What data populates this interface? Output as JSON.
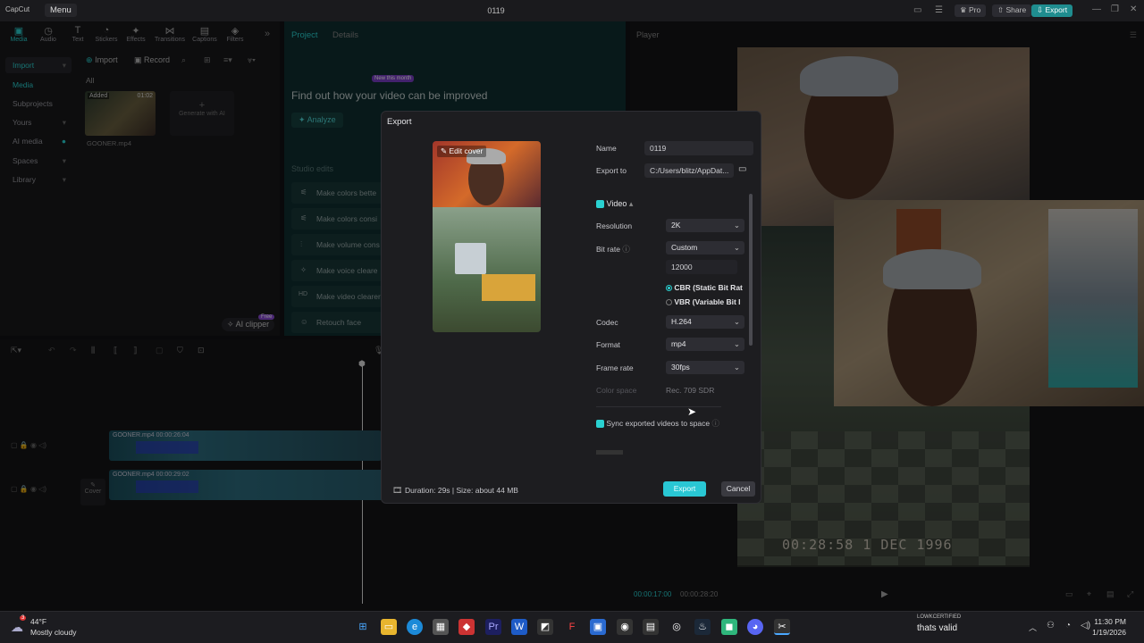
{
  "titlebar": {
    "logo": "CapCut",
    "menu": "Menu",
    "title": "0119",
    "pro": "Pro",
    "share": "Share",
    "export": "Export"
  },
  "tools": [
    {
      "label": "Media",
      "icon": "media-icon"
    },
    {
      "label": "Audio",
      "icon": "audio-icon"
    },
    {
      "label": "Text",
      "icon": "text-icon"
    },
    {
      "label": "Stickers",
      "icon": "stickers-icon"
    },
    {
      "label": "Effects",
      "icon": "effects-icon"
    },
    {
      "label": "Transitions",
      "icon": "transitions-icon"
    },
    {
      "label": "Captions",
      "icon": "captions-icon"
    },
    {
      "label": "Filters",
      "icon": "filters-icon"
    }
  ],
  "sidenav": [
    "Import",
    "Media",
    "Subprojects",
    "Yours",
    "AI media",
    "Spaces",
    "Library"
  ],
  "media": {
    "import": "Import",
    "record": "Record",
    "all": "All",
    "added": "Added",
    "clip_duration": "01:02",
    "clip_name": "GOONER.mp4",
    "generate": "Generate with AI",
    "ai_clipper": "AI clipper",
    "free": "Free"
  },
  "project": {
    "tab_project": "Project",
    "tab_details": "Details",
    "badge": "New this month",
    "heading": "Find out how your video can be improved",
    "analyze": "Analyze",
    "studio": "Studio edits",
    "items": [
      "Make colors bette",
      "Make colors consi",
      "Make volume cons",
      "Make voice cleare",
      "Make video clearer",
      "Retouch face"
    ]
  },
  "timeline": {
    "clip1": "GOONER.mp4  00:00:26:04",
    "clip2": "GOONER.mp4  00:00:29:02",
    "cover": "Cover"
  },
  "player": {
    "label": "Player",
    "timecode": "00:28:58 1 DEC 1996",
    "current": "00:00:17:00",
    "total": "00:00:28:20"
  },
  "export": {
    "title": "Export",
    "edit_cover": "Edit cover",
    "name_label": "Name",
    "name_value": "0119",
    "export_to_label": "Export to",
    "export_to_value": "C:/Users/blitz/AppDat...",
    "video_section": "Video",
    "resolution_label": "Resolution",
    "resolution_value": "2K",
    "bitrate_label": "Bit rate",
    "bitrate_value": "Custom",
    "bitrate_number": "12000",
    "cbr": "CBR (Static Bit Rat",
    "vbr": "VBR (Variable Bit I",
    "codec_label": "Codec",
    "codec_value": "H.264",
    "format_label": "Format",
    "format_value": "mp4",
    "framerate_label": "Frame rate",
    "framerate_value": "30fps",
    "colorspace_label": "Color space",
    "colorspace_value": "Rec. 709 SDR",
    "sync_label": "Sync exported videos to space",
    "duration_info": "Duration: 29s | Size: about 44 MB",
    "export_btn": "Export",
    "cancel_btn": "Cancel"
  },
  "taskbar": {
    "temp": "44°F",
    "weather": "Mostly cloudy",
    "badge": "3",
    "notif_title": "LOWKCERTIFIED",
    "notif_text": "thats valid",
    "time": "11:30 PM",
    "date": "1/19/2026"
  },
  "colors": {
    "accent": "#2ad1d1",
    "dialog_bg": "#1d1d20",
    "export_btn": "#29c7d4"
  }
}
